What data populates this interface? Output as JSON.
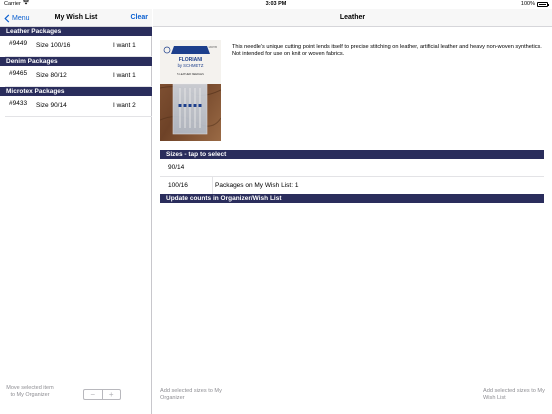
{
  "status_bar": {
    "carrier": "Carrier",
    "time": "3:03 PM",
    "battery": "100%",
    "battery_level": 1.0
  },
  "left": {
    "back_label": "Menu",
    "title": "My Wish List",
    "clear_label": "Clear",
    "groups": [
      {
        "header": "Leather Packages",
        "num": "#9449",
        "size": "Size 100/16",
        "want": "I want  1"
      },
      {
        "header": "Denim Packages",
        "num": "#9465",
        "size": "Size 80/12",
        "want": "I want  1"
      },
      {
        "header": "Microtex Packages",
        "num": "#9433",
        "size": "Size 90/14",
        "want": "I want  2"
      }
    ],
    "move_label": "Move selected item to My Organizer",
    "stepper_minus": "−",
    "stepper_plus": "+"
  },
  "right": {
    "title": "Leather",
    "description": "This needle's unique cutting point lends itself to precise stitching on leather, artificial leather and heavy non-woven synthetics. Not intended for use on knit or woven fabrics.",
    "product": {
      "brand": "FLORIANI",
      "sub": "by SCHMETZ",
      "label": "5 LEATHER NEEDLES",
      "code": "130/705"
    },
    "sizes_header": "Sizes - tap to select",
    "sizes": [
      {
        "size": "90/14",
        "packages": ""
      },
      {
        "size": "100/16",
        "packages": "Packages on My Wish List: 1"
      }
    ],
    "update_header": "Update counts in Organizer/Wish List",
    "footer_left": "Add selected sizes to My Organizer",
    "footer_right": "Add selected sizes to My Wish List"
  },
  "colors": {
    "header_bg": "#2a2d5c",
    "link_blue": "#0a5fd0",
    "muted": "#8e8e93"
  }
}
